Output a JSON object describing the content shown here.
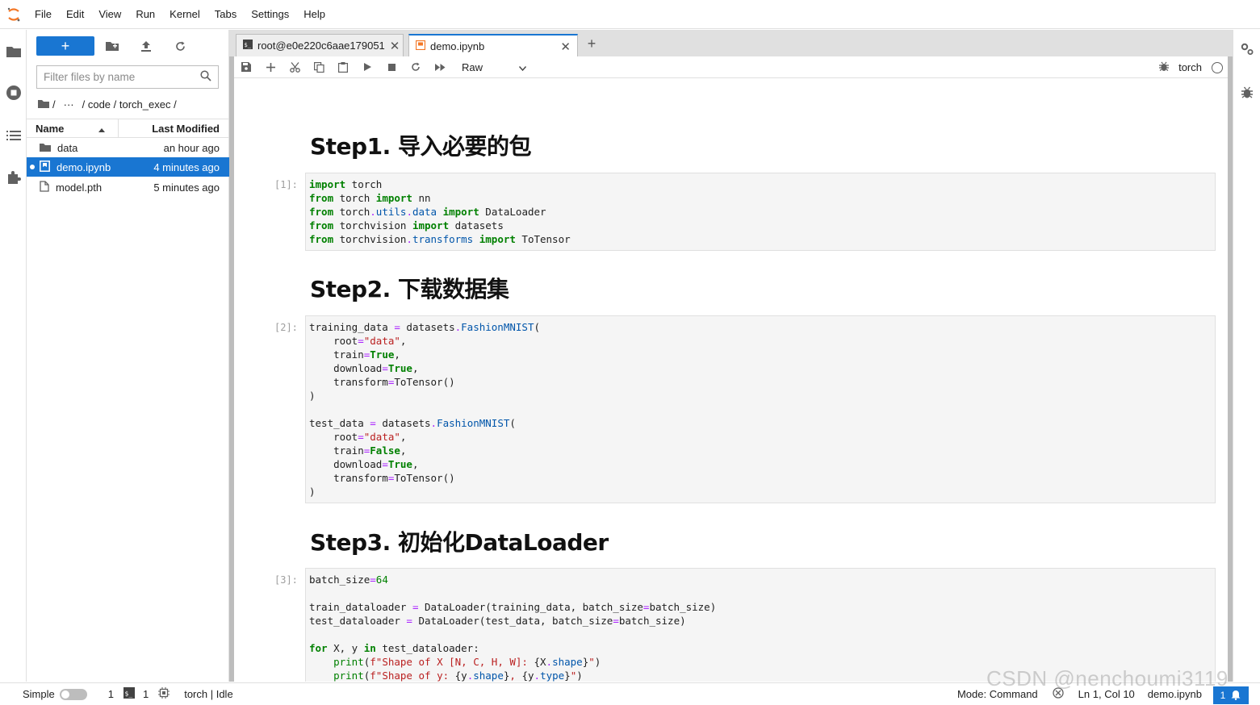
{
  "menubar": {
    "items": [
      "File",
      "Edit",
      "View",
      "Run",
      "Kernel",
      "Tabs",
      "Settings",
      "Help"
    ]
  },
  "filebrowser": {
    "new_label": "+",
    "filter_placeholder": "Filter files by name",
    "breadcrumb": [
      "/",
      "···",
      "/ code / torch_exec /"
    ],
    "columns": {
      "name": "Name",
      "modified": "Last Modified"
    },
    "files": [
      {
        "name": "data",
        "modified": "an hour ago",
        "kind": "folder-icon"
      },
      {
        "name": "demo.ipynb",
        "modified": "4 minutes ago",
        "kind": "notebook-icon",
        "selected": true
      },
      {
        "name": "model.pth",
        "modified": "5 minutes ago",
        "kind": "file-icon"
      }
    ]
  },
  "tabs": [
    {
      "title": "root@e0e220c6aae179051",
      "icon": "terminal-icon"
    },
    {
      "title": "demo.ipynb",
      "icon": "notebook-icon",
      "active": true
    }
  ],
  "notebook": {
    "cell_type": "Raw",
    "kernel_name": "torch",
    "headings": [
      "Step1. 导入必要的包",
      "Step2. 下载数据集",
      "Step3. 初始化DataLoader"
    ],
    "prompts": [
      "[1]:",
      "[2]:",
      "[3]:"
    ],
    "cells": [
      "import torch\nfrom torch import nn\nfrom torch.utils.data import DataLoader\nfrom torchvision import datasets\nfrom torchvision.transforms import ToTensor",
      "training_data = datasets.FashionMNIST(\n    root=\"data\",\n    train=True,\n    download=True,\n    transform=ToTensor()\n)\n\ntest_data = datasets.FashionMNIST(\n    root=\"data\",\n    train=False,\n    download=True,\n    transform=ToTensor()\n)",
      "batch_size=64\n\ntrain_dataloader = DataLoader(training_data, batch_size=batch_size)\ntest_dataloader = DataLoader(test_data, batch_size=batch_size)\n\nfor X, y in test_dataloader:\n    print(f\"Shape of X [N, C, H, W]: {X.shape}\")\n    print(f\"Shape of y: {y.shape}, {y.type}\")\n    break"
    ]
  },
  "statusbar": {
    "mode_label": "Simple",
    "terminals": "1",
    "kernels": "1",
    "kernel_status": "torch | Idle",
    "mode": "Mode: Command",
    "position": "Ln 1, Col 10",
    "filename": "demo.ipynb",
    "notifications": "1"
  },
  "watermark": "CSDN @nenchoumi3119",
  "colors": {
    "accent": "#1976d2",
    "keyword": "#008000",
    "attribute": "#0055aa",
    "string": "#ba2121"
  }
}
